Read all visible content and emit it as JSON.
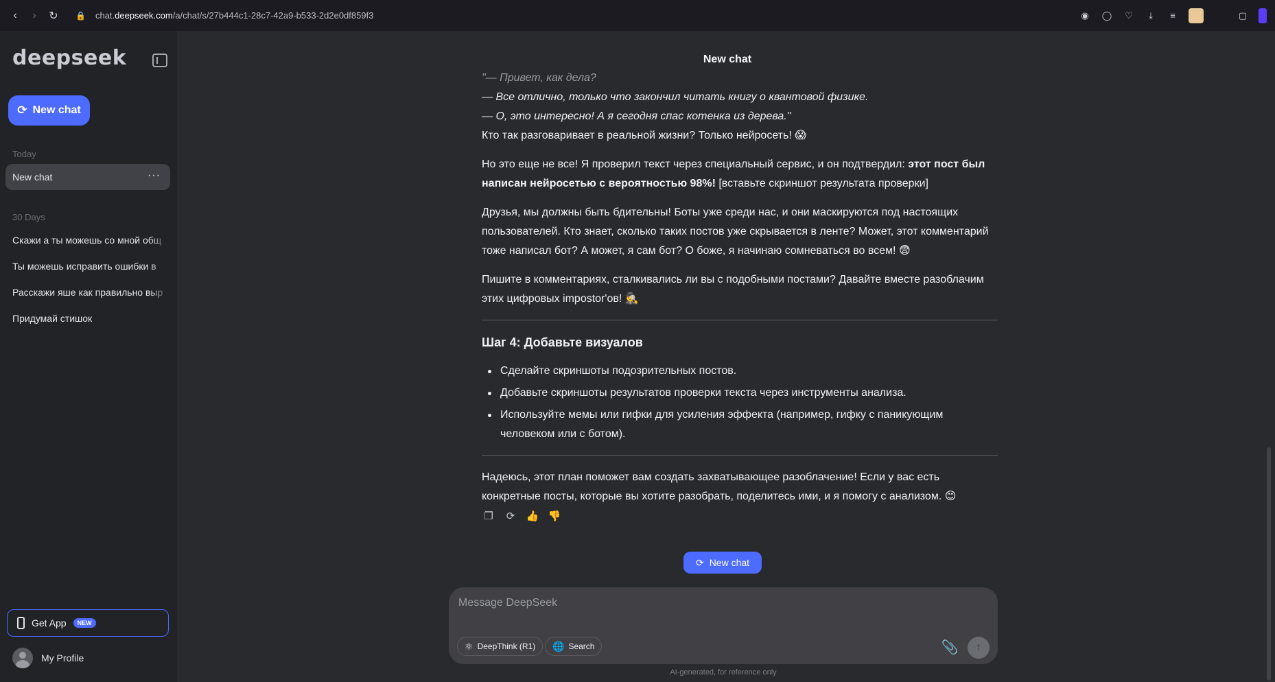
{
  "browser": {
    "url_prefix": "chat.",
    "url_domain": "deepseek.com",
    "url_path": "/a/chat/s/27b444c1-28c7-42a9-b533-2d2e0df859f3"
  },
  "sidebar": {
    "logo": "deepseek",
    "new_chat_label": "New chat",
    "section_today": "Today",
    "today_items": [
      {
        "label": "New chat"
      }
    ],
    "section_30days": "30 Days",
    "items_30days": [
      {
        "label": "Скажи а ты можешь со мной общ"
      },
      {
        "label": "Ты можешь исправить ошибки в"
      },
      {
        "label": "Расскажи яше как правильно выр"
      },
      {
        "label": "Придумай стишок"
      }
    ],
    "get_app_label": "Get App",
    "get_app_badge": "NEW",
    "profile_label": "My Profile"
  },
  "main": {
    "title": "New chat",
    "quote_line1": "\"— Привет, как дела?",
    "quote_line2": "— Все отлично, только что закончил читать книгу о квантовой физике.",
    "quote_line3": "— О, это интересно! А я сегодня спас котенка из дерева.\"",
    "para1": "Кто так разговаривает в реальной жизни? Только нейросеть! 😱",
    "para2_a": "Но это еще не все! Я проверил текст через специальный сервис, и он подтвердил: ",
    "para2_bold": "этот пост был написан нейросетью с вероятностью 98%!",
    "para2_b": " [вставьте скриншот результата проверки]",
    "para3": "Друзья, мы должны быть бдительны! Боты уже среди нас, и они маскируются под настоящих пользователей. Кто знает, сколько таких постов уже скрывается в ленте? Может, этот комментарий тоже написал бот? А может, я сам бот? О боже, я начинаю сомневаться во всем! 😨",
    "para4": "Пишите в комментариях, сталкивались ли вы с подобными постами? Давайте вместе разоблачим этих цифровых impostor'ов! 🕵️",
    "step4_heading": "Шаг 4: Добавьте визуалов",
    "step4_items": [
      "Сделайте скриншоты подозрительных постов.",
      "Добавьте скриншоты результатов проверки текста через инструменты анализа.",
      "Используйте мемы или гифки для усиления эффекта (например, гифку с паникующим человеком или с ботом)."
    ],
    "closing": "Надеюсь, этот план поможет вам создать захватывающее разоблачение! Если у вас есть конкретные посты, которые вы хотите разобрать, поделитесь ими, и я помогу с анализом. 😊",
    "new_chat_button": "New chat"
  },
  "composer": {
    "placeholder": "Message DeepSeek",
    "deepthink_label": "DeepThink (R1)",
    "search_label": "Search",
    "disclaimer": "AI-generated, for reference only"
  },
  "colors": {
    "accent": "#4d6bfe",
    "sidebar_bg": "#212327",
    "main_bg": "#292a2d",
    "composer_bg": "#404045"
  },
  "icons": [
    "back-icon",
    "forward-icon",
    "reload-icon",
    "lock-icon",
    "screenshot-icon",
    "shield-icon",
    "heart-icon",
    "download-icon",
    "menu-icon",
    "extension-icon",
    "collapse-sidebar-icon",
    "new-chat-icon",
    "more-icon",
    "phone-icon",
    "copy-icon",
    "regenerate-icon",
    "thumbs-up-icon",
    "thumbs-down-icon",
    "atom-icon",
    "globe-icon",
    "paperclip-icon",
    "arrow-up-icon"
  ]
}
